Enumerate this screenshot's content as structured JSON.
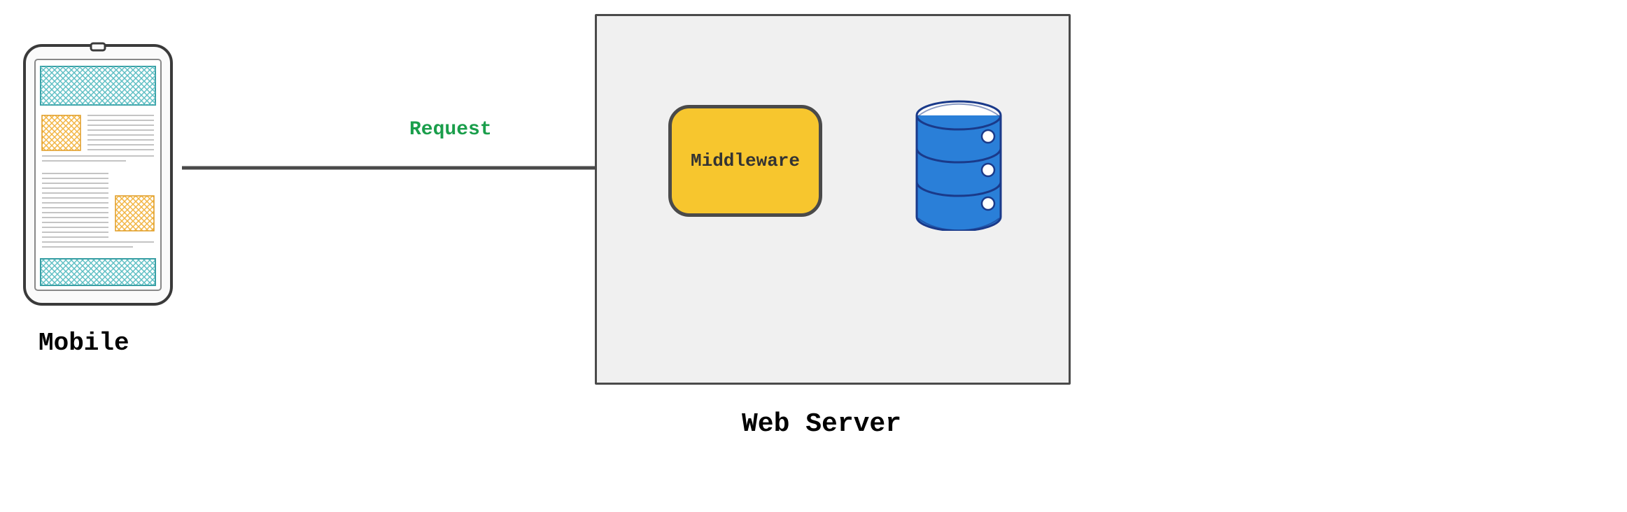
{
  "diagram": {
    "mobile_label": "Mobile",
    "request_label": "Request",
    "middleware_label": "Middleware",
    "webserver_label": "Web Server",
    "colors": {
      "arrow": "#4a4a4a",
      "request_text": "#1a9e4b",
      "middleware_fill": "#f7c62e",
      "middleware_stroke": "#4a4a4a",
      "server_box_fill": "#f0f0f0",
      "server_box_stroke": "#4a4a4a",
      "database_fill": "#2a7fd8",
      "database_stroke": "#1a3a8a",
      "mobile_teal": "#5fbfc4",
      "mobile_orange": "#f2b544"
    }
  }
}
